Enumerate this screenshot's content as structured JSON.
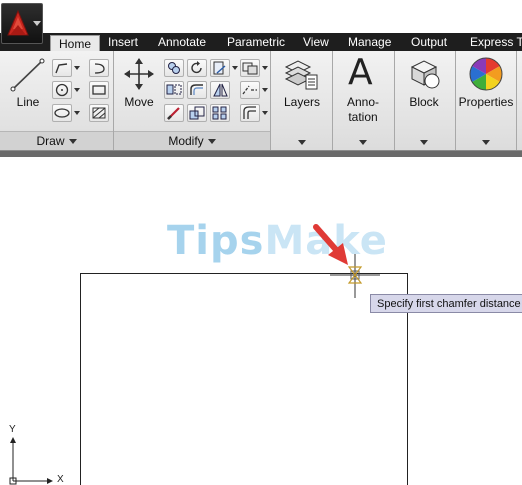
{
  "tabs": [
    "Home",
    "Insert",
    "Annotate",
    "Parametric",
    "View",
    "Manage",
    "Output",
    "Express To"
  ],
  "ribbon": {
    "draw": {
      "line_label": "Line",
      "panel_label": "Draw"
    },
    "modify": {
      "move_label": "Move",
      "panel_label": "Modify"
    },
    "layers_label": "Layers",
    "annotation_label_1": "Anno-",
    "annotation_label_2": "tation",
    "annotation_glyph": "A",
    "block_label": "Block",
    "properties_label": "Properties"
  },
  "watermark": {
    "part1": "Tips",
    "part2": "Make"
  },
  "tooltip": "Specify first chamfer distance",
  "ucs": {
    "y": "Y",
    "x": "X"
  },
  "colors": {
    "tab_bar": "#1e1e1e",
    "tooltip_bg": "#d7d7ea",
    "arrow": "#e03a36",
    "app_logo": "#c8261e"
  }
}
